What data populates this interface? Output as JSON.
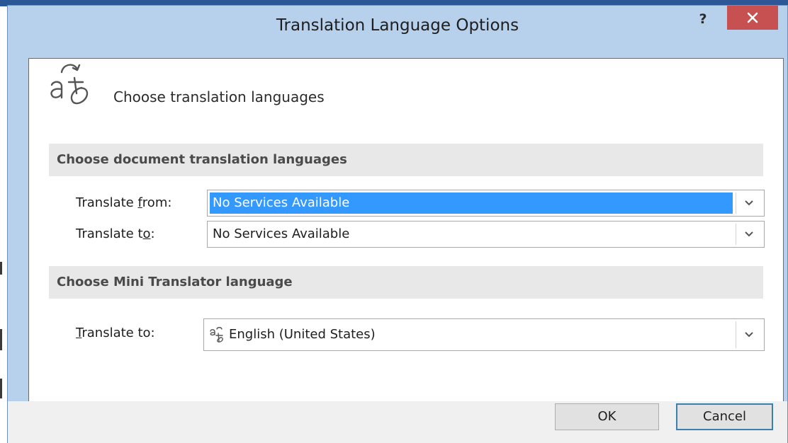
{
  "dialog": {
    "title": "Translation Language Options",
    "help_label": "?"
  },
  "header": {
    "text": "Choose translation languages",
    "icon": "translate-icon"
  },
  "document_section": {
    "heading": "Choose document translation languages",
    "translate_from": {
      "label_prefix": "Translate ",
      "label_accel": "f",
      "label_suffix": "rom:",
      "value": "No Services Available"
    },
    "translate_to": {
      "label_prefix": "Translate t",
      "label_accel": "o",
      "label_suffix": ":",
      "value": "No Services Available"
    }
  },
  "mini_section": {
    "heading": "Choose Mini Translator language",
    "translate_to": {
      "label_prefix": "",
      "label_accel": "T",
      "label_suffix": "ranslate to:",
      "value": "English (United States)",
      "icon": "translate-icon"
    }
  },
  "buttons": {
    "ok": "OK",
    "cancel": "Cancel"
  },
  "colors": {
    "title_bar": "#b7d0ec",
    "close_button": "#c75050",
    "selection": "#3399ff",
    "section_header_bg": "#e8e8e8",
    "default_button_border": "#3c7fb1"
  }
}
